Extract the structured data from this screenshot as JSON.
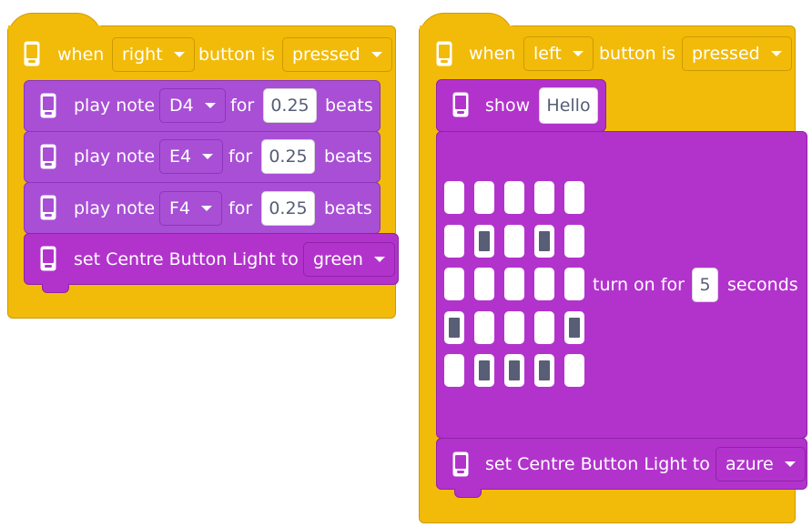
{
  "script_left": {
    "event": {
      "prefix": "when",
      "button": "right",
      "middle": "button is",
      "state": "pressed"
    },
    "notes": [
      {
        "label": "play note",
        "note": "D4",
        "for": "for",
        "beats_value": "0.25",
        "beats_label": "beats"
      },
      {
        "label": "play note",
        "note": "E4",
        "for": "for",
        "beats_value": "0.25",
        "beats_label": "beats"
      },
      {
        "label": "play note",
        "note": "F4",
        "for": "for",
        "beats_value": "0.25",
        "beats_label": "beats"
      }
    ],
    "light": {
      "label": "set Centre Button Light to",
      "color": "green"
    }
  },
  "script_right": {
    "event": {
      "prefix": "when",
      "button": "left",
      "middle": "button is",
      "state": "pressed"
    },
    "show": {
      "label": "show",
      "text": "Hello"
    },
    "matrix": {
      "label_before": "turn on for",
      "seconds_value": "5",
      "label_after": "seconds",
      "pattern": [
        [
          0,
          0,
          0,
          0,
          0
        ],
        [
          0,
          1,
          0,
          1,
          0
        ],
        [
          0,
          0,
          0,
          0,
          0
        ],
        [
          1,
          0,
          0,
          0,
          1
        ],
        [
          0,
          1,
          1,
          1,
          0
        ]
      ]
    },
    "light": {
      "label": "set Centre Button Light to",
      "color": "azure"
    }
  },
  "colors": {
    "event_yellow": "#f2bb0a",
    "note_purple": "#a84fd6",
    "hub_purple": "#b233cc",
    "pixel_on": "#575e75"
  },
  "icons": {
    "hub": "hub-icon",
    "dropdown": "caret-down-icon"
  }
}
